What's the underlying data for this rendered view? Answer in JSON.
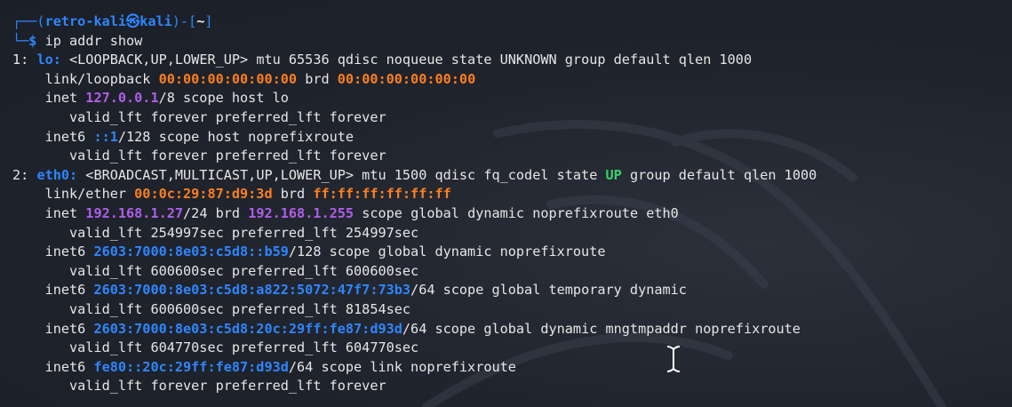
{
  "terminal": {
    "lines": [
      {
        "segments": [
          {
            "t": "┌──(",
            "c": "blue",
            "b": false
          },
          {
            "t": "retro-kali㉿kali",
            "c": "blue",
            "b": true
          },
          {
            "t": ")-[",
            "c": "blue",
            "b": false
          },
          {
            "t": "~",
            "c": "default",
            "b": true
          },
          {
            "t": "]",
            "c": "blue",
            "b": false
          }
        ]
      },
      {
        "segments": [
          {
            "t": "└─",
            "c": "blue",
            "b": false
          },
          {
            "t": "$",
            "c": "blue",
            "b": true
          },
          {
            "t": " ip addr show",
            "c": "default",
            "b": false
          }
        ]
      },
      {
        "segments": [
          {
            "t": "1: ",
            "c": "default",
            "b": false
          },
          {
            "t": "lo:",
            "c": "blue",
            "b": true
          },
          {
            "t": " <LOOPBACK,UP,LOWER_UP> mtu 65536 qdisc noqueue state UNKNOWN group default qlen 1000",
            "c": "default",
            "b": false
          }
        ]
      },
      {
        "segments": [
          {
            "t": "    link/loopback ",
            "c": "default",
            "b": false
          },
          {
            "t": "00:00:00:00:00:00",
            "c": "orange",
            "b": true
          },
          {
            "t": " brd ",
            "c": "default",
            "b": false
          },
          {
            "t": "00:00:00:00:00:00",
            "c": "orange",
            "b": true
          }
        ]
      },
      {
        "segments": [
          {
            "t": "    inet ",
            "c": "default",
            "b": false
          },
          {
            "t": "127.0.0.1",
            "c": "purple",
            "b": true
          },
          {
            "t": "/8 scope host lo",
            "c": "default",
            "b": false
          }
        ]
      },
      {
        "segments": [
          {
            "t": "       valid_lft forever preferred_lft forever",
            "c": "default",
            "b": false
          }
        ]
      },
      {
        "segments": [
          {
            "t": "    inet6 ",
            "c": "default",
            "b": false
          },
          {
            "t": "::1",
            "c": "blue",
            "b": true
          },
          {
            "t": "/128 scope host noprefixroute",
            "c": "default",
            "b": false
          }
        ]
      },
      {
        "segments": [
          {
            "t": "       valid_lft forever preferred_lft forever",
            "c": "default",
            "b": false
          }
        ]
      },
      {
        "segments": [
          {
            "t": "2: ",
            "c": "default",
            "b": false
          },
          {
            "t": "eth0:",
            "c": "blue",
            "b": true
          },
          {
            "t": " <BROADCAST,MULTICAST,UP,LOWER_UP> mtu 1500 qdisc fq_codel state ",
            "c": "default",
            "b": false
          },
          {
            "t": "UP",
            "c": "green",
            "b": true
          },
          {
            "t": " group default qlen 1000",
            "c": "default",
            "b": false
          }
        ]
      },
      {
        "segments": [
          {
            "t": "    link/ether ",
            "c": "default",
            "b": false
          },
          {
            "t": "00:0c:29:87:d9:3d",
            "c": "orange",
            "b": true
          },
          {
            "t": " brd ",
            "c": "default",
            "b": false
          },
          {
            "t": "ff:ff:ff:ff:ff:ff",
            "c": "orange",
            "b": true
          }
        ]
      },
      {
        "segments": [
          {
            "t": "    inet ",
            "c": "default",
            "b": false
          },
          {
            "t": "192.168.1.27",
            "c": "purple",
            "b": true
          },
          {
            "t": "/24 brd ",
            "c": "default",
            "b": false
          },
          {
            "t": "192.168.1.255",
            "c": "purple",
            "b": true
          },
          {
            "t": " scope global dynamic noprefixroute eth0",
            "c": "default",
            "b": false
          }
        ]
      },
      {
        "segments": [
          {
            "t": "       valid_lft 254997sec preferred_lft 254997sec",
            "c": "default",
            "b": false
          }
        ]
      },
      {
        "segments": [
          {
            "t": "    inet6 ",
            "c": "default",
            "b": false
          },
          {
            "t": "2603:7000:8e03:c5d8::b59",
            "c": "blue",
            "b": true
          },
          {
            "t": "/128 scope global dynamic noprefixroute",
            "c": "default",
            "b": false
          }
        ]
      },
      {
        "segments": [
          {
            "t": "       valid_lft 600600sec preferred_lft 600600sec",
            "c": "default",
            "b": false
          }
        ]
      },
      {
        "segments": [
          {
            "t": "    inet6 ",
            "c": "default",
            "b": false
          },
          {
            "t": "2603:7000:8e03:c5d8:a822:5072:47f7:73b3",
            "c": "blue",
            "b": true
          },
          {
            "t": "/64 scope global temporary dynamic",
            "c": "default",
            "b": false
          }
        ]
      },
      {
        "segments": [
          {
            "t": "       valid_lft 600600sec preferred_lft 81854sec",
            "c": "default",
            "b": false
          }
        ]
      },
      {
        "segments": [
          {
            "t": "    inet6 ",
            "c": "default",
            "b": false
          },
          {
            "t": "2603:7000:8e03:c5d8:20c:29ff:fe87:d93d",
            "c": "blue",
            "b": true
          },
          {
            "t": "/64 scope global dynamic mngtmpaddr noprefixroute",
            "c": "default",
            "b": false
          }
        ]
      },
      {
        "segments": [
          {
            "t": "       valid_lft 604770sec preferred_lft 604770sec",
            "c": "default",
            "b": false
          }
        ]
      },
      {
        "segments": [
          {
            "t": "    inet6 ",
            "c": "default",
            "b": false
          },
          {
            "t": "fe80::20c:29ff:fe87:d93d",
            "c": "blue",
            "b": true
          },
          {
            "t": "/64 scope link noprefixroute",
            "c": "default",
            "b": false
          }
        ]
      },
      {
        "segments": [
          {
            "t": "       valid_lft forever preferred_lft forever",
            "c": "default",
            "b": false
          }
        ]
      }
    ]
  },
  "colors": {
    "background": "#1f232c",
    "blue": "#2e86ff",
    "orange": "#ff7f1e",
    "purple": "#b05ee8",
    "green": "#35d16b",
    "default": "#e6e6e6"
  },
  "icons": {
    "cursor": "i-beam-cursor-icon",
    "background_art": "kali-dragon-watermark-icon"
  }
}
